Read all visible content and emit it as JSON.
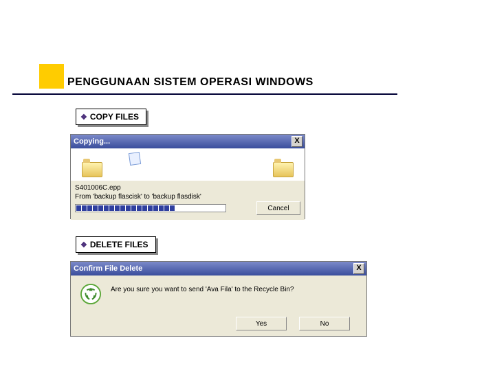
{
  "slide": {
    "title": "PENGGUNAAN SISTEM OPERASI WINDOWS"
  },
  "sections": {
    "copy_label": "COPY FILES",
    "delete_label": "DELETE FILES"
  },
  "copy_dialog": {
    "title": "Copying...",
    "close": "X",
    "file": "S401006C.epp",
    "from_to": "From 'backup flascisk' to 'backup flasdisk'",
    "cancel": "Cancel"
  },
  "delete_dialog": {
    "title": "Confirm File Delete",
    "close": "X",
    "message": "Are you sure you want to send 'Ava Fila' to the Recycle Bin?",
    "yes": "Yes",
    "no": "No"
  }
}
